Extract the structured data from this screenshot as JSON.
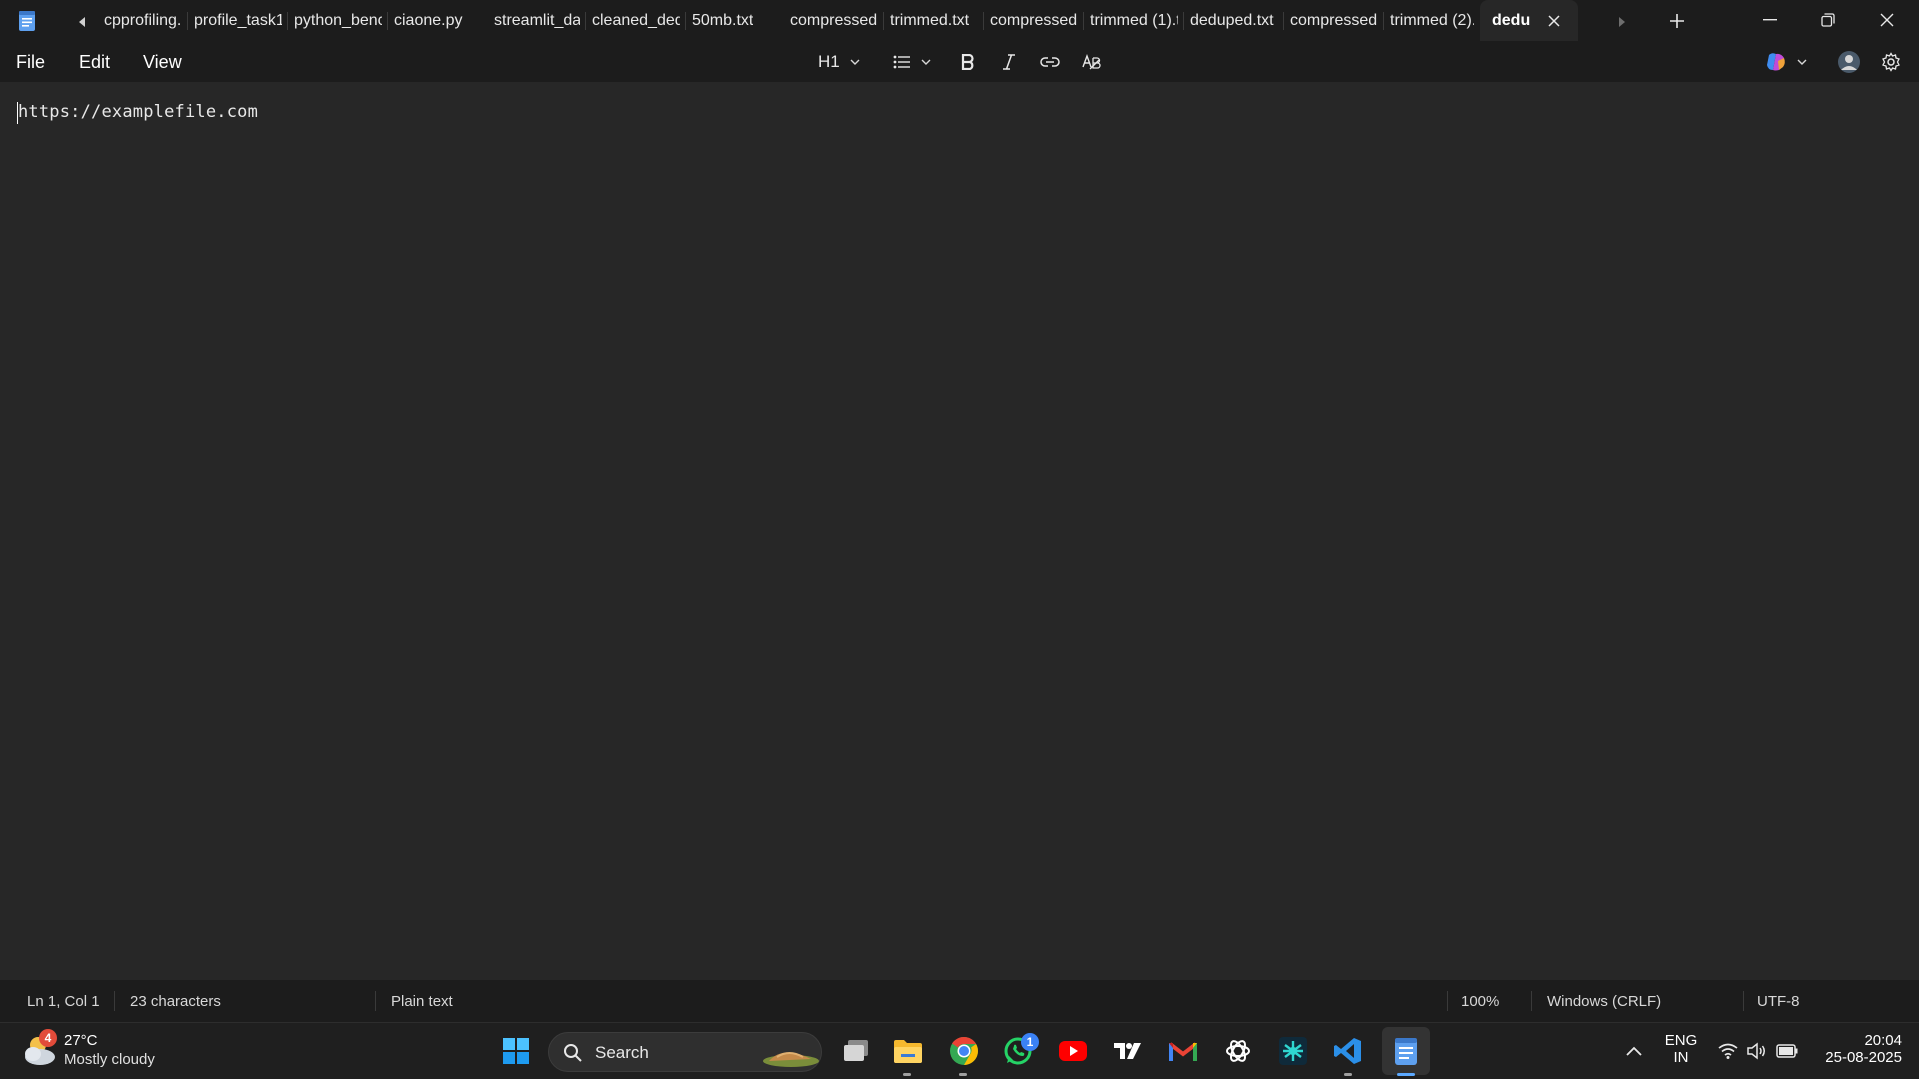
{
  "window": {
    "app_name": "Notepad",
    "active_tab_title": "dedu",
    "tabs": [
      {
        "label": "cpprofiling.c"
      },
      {
        "label": "profile_task1"
      },
      {
        "label": "python_benc"
      },
      {
        "label": "ciaone.py"
      },
      {
        "label": "streamlit_da"
      },
      {
        "label": "cleaned_ded"
      },
      {
        "label": "50mb.txt"
      },
      {
        "label": "compressed."
      },
      {
        "label": "trimmed.txt"
      },
      {
        "label": "compressed"
      },
      {
        "label": "trimmed (1).t"
      },
      {
        "label": "deduped.txt"
      },
      {
        "label": "compressed"
      },
      {
        "label": "trimmed (2)."
      }
    ]
  },
  "menu": {
    "file": "File",
    "edit": "Edit",
    "view": "View"
  },
  "toolbar": {
    "heading": "H1"
  },
  "editor": {
    "content": "https://examplefile.com"
  },
  "status": {
    "position": "Ln 1, Col 1",
    "characters": "23 characters",
    "format": "Plain text",
    "zoom": "100%",
    "line_ending": "Windows (CRLF)",
    "encoding": "UTF-8"
  },
  "taskbar": {
    "weather_temp": "27°C",
    "weather_desc": "Mostly cloudy",
    "weather_badge": "4",
    "search_placeholder": "Search",
    "whatsapp_badge": "1",
    "language_top": "ENG",
    "language_bottom": "IN",
    "time": "20:04",
    "date": "25-08-2025"
  },
  "colors": {
    "background": "#272727",
    "chrome": "#1c1c1c",
    "accent": "#5ca9ff"
  }
}
